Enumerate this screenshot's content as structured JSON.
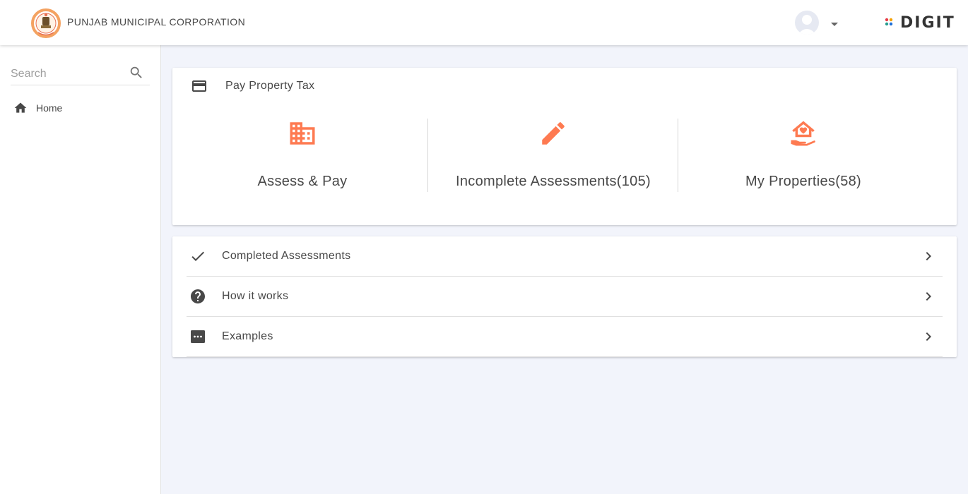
{
  "header": {
    "org_name": "PUNJAB MUNICIPAL CORPORATION",
    "brand": "DIGIT",
    "emblem_icon": "punjab-emblem-logo",
    "avatar_icon": "user-avatar-icon",
    "menu_icon": "caret-down-icon"
  },
  "sidebar": {
    "search": {
      "placeholder": "Search",
      "value": ""
    },
    "items": [
      {
        "label": "Home",
        "icon": "home-icon"
      }
    ]
  },
  "main": {
    "pay_card": {
      "title": "Pay Property Tax",
      "title_icon": "credit-card-icon",
      "tiles": [
        {
          "label": "Assess & Pay",
          "icon": "building-icon"
        },
        {
          "label": "Incomplete Assessments(105)",
          "icon": "pencil-icon"
        },
        {
          "label": "My Properties(58)",
          "icon": "home-in-hand-icon"
        }
      ]
    },
    "list_card": {
      "items": [
        {
          "label": "Completed Assessments",
          "icon": "check-icon"
        },
        {
          "label": "How it works",
          "icon": "help-circle-icon"
        },
        {
          "label": "Examples",
          "icon": "more-box-icon"
        }
      ]
    }
  },
  "colors": {
    "accent": "#fe7a51",
    "icon": "#484848",
    "background": "#f2f4fb",
    "card": "#ffffff"
  }
}
